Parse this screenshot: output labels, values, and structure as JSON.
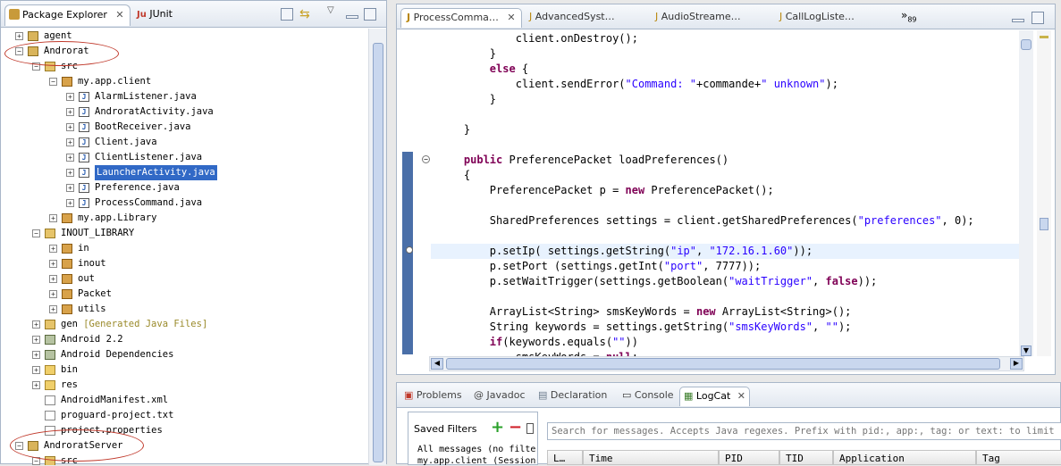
{
  "explorer": {
    "tabs": [
      "Package Explorer",
      "JUnit"
    ],
    "tree": [
      {
        "label": "agent",
        "level": 0,
        "exp": "+",
        "icon": "project",
        "sel": false
      },
      {
        "label": "Androrat",
        "level": 0,
        "exp": "−",
        "icon": "project",
        "sel": false
      },
      {
        "label": "src",
        "level": 1,
        "exp": "−",
        "icon": "srcfolder",
        "sel": false
      },
      {
        "label": "my.app.client",
        "level": 2,
        "exp": "−",
        "icon": "package",
        "sel": false
      },
      {
        "label": "AlarmListener.java",
        "level": 3,
        "exp": "+",
        "icon": "java",
        "sel": false
      },
      {
        "label": "AndroratActivity.java",
        "level": 3,
        "exp": "+",
        "icon": "java",
        "sel": false
      },
      {
        "label": "BootReceiver.java",
        "level": 3,
        "exp": "+",
        "icon": "java",
        "sel": false
      },
      {
        "label": "Client.java",
        "level": 3,
        "exp": "+",
        "icon": "java",
        "sel": false
      },
      {
        "label": "ClientListener.java",
        "level": 3,
        "exp": "+",
        "icon": "java",
        "sel": false
      },
      {
        "label": "LauncherActivity.java",
        "level": 3,
        "exp": "+",
        "icon": "java",
        "sel": true
      },
      {
        "label": "Preference.java",
        "level": 3,
        "exp": "+",
        "icon": "java",
        "sel": false
      },
      {
        "label": "ProcessCommand.java",
        "level": 3,
        "exp": "+",
        "icon": "java",
        "sel": false
      },
      {
        "label": "my.app.Library",
        "level": 2,
        "exp": "+",
        "icon": "package",
        "sel": false
      },
      {
        "label": "INOUT_LIBRARY",
        "level": 1,
        "exp": "−",
        "icon": "srcfolder",
        "sel": false
      },
      {
        "label": "in",
        "level": 2,
        "exp": "+",
        "icon": "package",
        "sel": false
      },
      {
        "label": "inout",
        "level": 2,
        "exp": "+",
        "icon": "package",
        "sel": false
      },
      {
        "label": "out",
        "level": 2,
        "exp": "+",
        "icon": "package",
        "sel": false
      },
      {
        "label": "Packet",
        "level": 2,
        "exp": "+",
        "icon": "package",
        "sel": false
      },
      {
        "label": "utils",
        "level": 2,
        "exp": "+",
        "icon": "package",
        "sel": false
      },
      {
        "label": "gen",
        "suffix": "[Generated Java Files]",
        "level": 1,
        "exp": "+",
        "icon": "srcfolder",
        "sel": false
      },
      {
        "label": "Android 2.2",
        "level": 1,
        "exp": "+",
        "icon": "library",
        "sel": false
      },
      {
        "label": "Android Dependencies",
        "level": 1,
        "exp": "+",
        "icon": "library",
        "sel": false
      },
      {
        "label": "bin",
        "level": 1,
        "exp": "+",
        "icon": "folder",
        "sel": false
      },
      {
        "label": "res",
        "level": 1,
        "exp": "+",
        "icon": "folder",
        "sel": false
      },
      {
        "label": "AndroidManifest.xml",
        "level": 1,
        "exp": "",
        "icon": "file",
        "sel": false
      },
      {
        "label": "proguard-project.txt",
        "level": 1,
        "exp": "",
        "icon": "file",
        "sel": false
      },
      {
        "label": "project.properties",
        "level": 1,
        "exp": "",
        "icon": "file",
        "sel": false
      },
      {
        "label": "AndroratServer",
        "level": 0,
        "exp": "−",
        "icon": "project",
        "sel": false
      },
      {
        "label": "src",
        "level": 1,
        "exp": "−",
        "icon": "srcfolder",
        "sel": false
      }
    ]
  },
  "editor": {
    "tabs": [
      "ProcessComma…",
      "AdvancedSyst…",
      "AudioStreame…",
      "CallLogListe…"
    ],
    "overflow": "»",
    "overflow_count": "89",
    "lines": [
      [
        [
          "",
          "            client.onDestroy();"
        ]
      ],
      [
        [
          "",
          "        }"
        ]
      ],
      [
        [
          "kw",
          "        else"
        ],
        [
          "",
          " {"
        ]
      ],
      [
        [
          "",
          "            client.sendError("
        ],
        [
          "st",
          "\"Command: \""
        ],
        [
          "",
          "+commande+"
        ],
        [
          "st",
          "\" unknown\""
        ],
        [
          "",
          ");"
        ]
      ],
      [
        [
          "",
          "        }"
        ]
      ],
      [
        [
          "",
          ""
        ]
      ],
      [
        [
          "",
          "    }"
        ]
      ],
      [
        [
          "",
          ""
        ]
      ],
      [
        [
          "kw",
          "    public"
        ],
        [
          "",
          " PreferencePacket loadPreferences()"
        ]
      ],
      [
        [
          "",
          "    {"
        ]
      ],
      [
        [
          "",
          "        PreferencePacket p = "
        ],
        [
          "kw",
          "new"
        ],
        [
          "",
          " PreferencePacket();"
        ]
      ],
      [
        [
          "",
          ""
        ]
      ],
      [
        [
          "",
          "        SharedPreferences settings = client.getSharedPreferences("
        ],
        [
          "st",
          "\"preferences\""
        ],
        [
          "",
          ", 0);"
        ]
      ],
      [
        [
          "",
          ""
        ]
      ],
      [
        [
          "",
          "        p.setIp( settings.getString("
        ],
        [
          "st",
          "\"ip\""
        ],
        [
          "",
          ", "
        ],
        [
          "st",
          "\"172.16.1.60\""
        ],
        [
          "",
          "));"
        ]
      ],
      [
        [
          "",
          "        p.setPort (settings.getInt("
        ],
        [
          "st",
          "\"port\""
        ],
        [
          "",
          ", 7777));"
        ]
      ],
      [
        [
          "",
          "        p.setWaitTrigger(settings.getBoolean("
        ],
        [
          "st",
          "\"waitTrigger\""
        ],
        [
          "",
          ", "
        ],
        [
          "kw",
          "false"
        ],
        [
          "",
          "));"
        ]
      ],
      [
        [
          "",
          ""
        ]
      ],
      [
        [
          "",
          "        ArrayList<String> smsKeyWords = "
        ],
        [
          "kw",
          "new"
        ],
        [
          "",
          " ArrayList<String>();"
        ]
      ],
      [
        [
          "",
          "        String keywords = settings.getString("
        ],
        [
          "st",
          "\"smsKeyWords\""
        ],
        [
          "",
          ", "
        ],
        [
          "st",
          "\"\""
        ],
        [
          "",
          ");"
        ]
      ],
      [
        [
          "kw",
          "        if"
        ],
        [
          "",
          "(keywords.equals("
        ],
        [
          "st",
          "\"\""
        ],
        [
          "",
          "))"
        ]
      ],
      [
        [
          "",
          "            smsKeyWords = "
        ],
        [
          "kw",
          "null"
        ],
        [
          "",
          ";"
        ]
      ]
    ]
  },
  "bottom": {
    "tabs": [
      "Problems",
      "@ Javadoc",
      "Declaration",
      "Console",
      "LogCat"
    ],
    "saved_filters": "Saved Filters",
    "filter_items": [
      "All messages (no filte",
      "my.app.client (Session"
    ],
    "search_placeholder": "Search for messages. Accepts Java regexes. Prefix with pid:, app:, tag: or text: to limit scope.",
    "columns": [
      "L…",
      "Time",
      "PID",
      "TID",
      "Application",
      "Tag"
    ]
  }
}
